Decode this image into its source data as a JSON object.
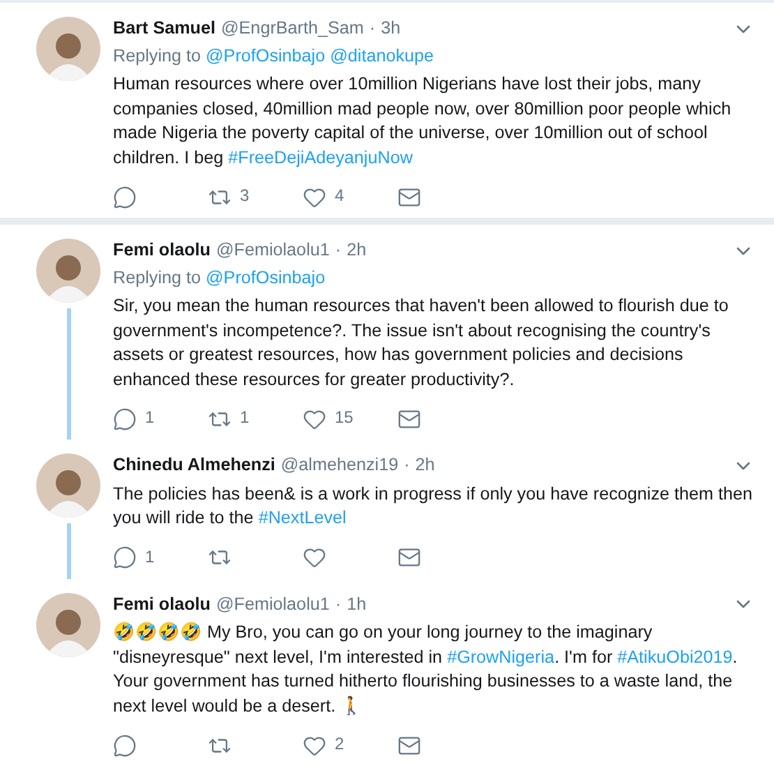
{
  "tweets": [
    {
      "name": "Bart Samuel",
      "handle": "@EngrBarth_Sam",
      "separator": "·",
      "time": "3h",
      "replying_label": "Replying to",
      "replying_to": [
        "@ProfOsinbajo",
        "@ditanokupe"
      ],
      "body": [
        {
          "kind": "text",
          "text": "Human resources where over 10million Nigerians have lost their jobs, many companies closed, 40million mad people now, over 80million poor people which made Nigeria the poverty capital of the universe, over 10million out of school children. I beg "
        },
        {
          "kind": "hashtag",
          "text": "#FreeDejiAdeyanjuNow"
        }
      ],
      "retweets": "3",
      "likes": "4",
      "thread_continues": false
    },
    {
      "name": "Femi olaolu",
      "handle": "@Femiolaolu1",
      "separator": "·",
      "time": "2h",
      "replying_label": "Replying to",
      "replying_to": [
        "@ProfOsinbajo"
      ],
      "body": [
        {
          "kind": "text",
          "text": "Sir, you mean the human resources that haven't been allowed to flourish due to government's incompetence?. The issue isn't about recognising the country's assets or greatest resources, how has government policies and decisions enhanced these resources for greater productivity?."
        }
      ],
      "replies": "1",
      "retweets": "1",
      "likes": "15",
      "thread_continues": true
    },
    {
      "name": "Chinedu Almehenzi",
      "handle": "@almehenzi19",
      "separator": "·",
      "time": "2h",
      "body": [
        {
          "kind": "text",
          "text": "The policies has been& is a work in progress if only you have recognize them then you will ride to the "
        },
        {
          "kind": "hashtag",
          "text": "#NextLevel"
        }
      ],
      "replies": "1",
      "thread_continues": true
    },
    {
      "name": "Femi olaolu",
      "handle": "@Femiolaolu1",
      "separator": "·",
      "time": "1h",
      "body": [
        {
          "kind": "text",
          "text": "🤣🤣🤣🤣 My Bro, you can go on your long journey to the imaginary \"disneyresque\" next level, I'm interested in "
        },
        {
          "kind": "hashtag",
          "text": "#GrowNigeria"
        },
        {
          "kind": "text",
          "text": ". I'm for "
        },
        {
          "kind": "hashtag",
          "text": "#AtikuObi2019"
        },
        {
          "kind": "text",
          "text": ". Your government has turned hitherto flourishing businesses to a waste land, the next level would be a desert. 🚶"
        }
      ],
      "likes": "2",
      "thread_continues": false
    }
  ]
}
